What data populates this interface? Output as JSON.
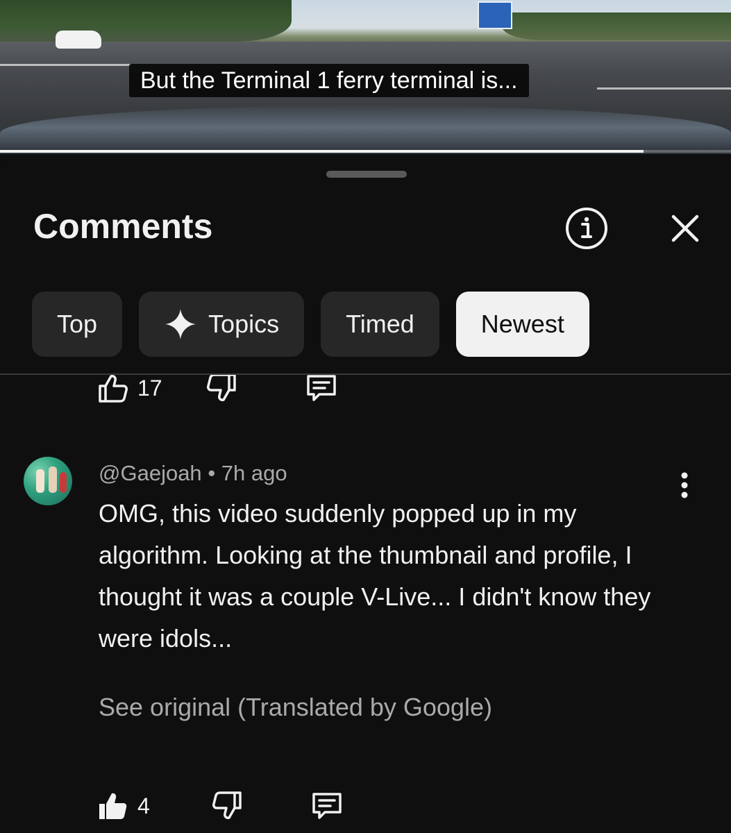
{
  "video": {
    "subtitle": "But the Terminal 1 ferry terminal is...",
    "progress": 0.88
  },
  "sheet": {
    "title": "Comments",
    "info_icon": "info-circle-icon",
    "close_icon": "close-icon"
  },
  "chips": [
    {
      "label": "Top",
      "selected": false
    },
    {
      "label": "Topics",
      "selected": false,
      "icon": "sparkle-icon"
    },
    {
      "label": "Timed",
      "selected": false
    },
    {
      "label": "Newest",
      "selected": true
    }
  ],
  "prev_comment": {
    "likes": "17"
  },
  "comment": {
    "author": "@Gaejoah",
    "separator": "•",
    "time": "7h ago",
    "text": "OMG, this video suddenly popped up in my algorithm. Looking at the thumbnail and profile, I thought it was a couple V-Live... I didn't know they were idols...",
    "translation_note": "See original (Translated by Google)",
    "likes": "4"
  },
  "colors": {
    "background": "#0f0f0f",
    "chip_bg": "#272727",
    "chip_selected_bg": "#f1f1f1",
    "secondary_text": "#aaaaaa"
  }
}
